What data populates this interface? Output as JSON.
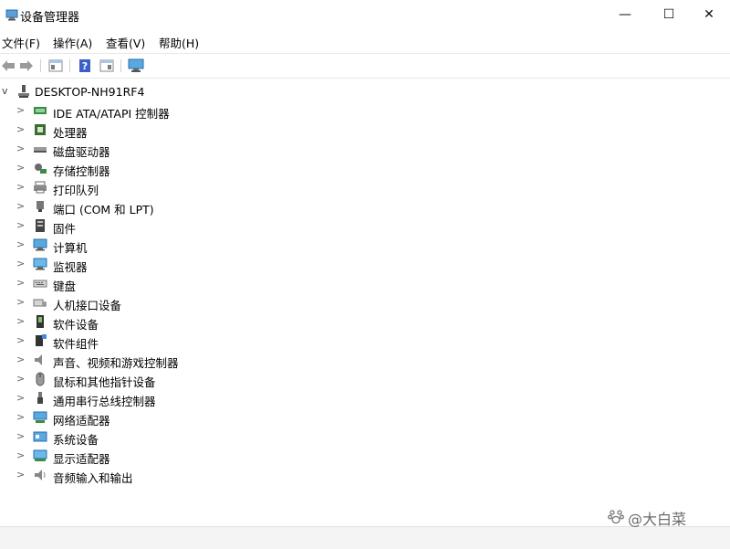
{
  "window": {
    "title": "设备管理器",
    "minimize_glyph": "—",
    "maximize_glyph": "☐",
    "close_glyph": "✕"
  },
  "menu": [
    "文件(F)",
    "操作(A)",
    "查看(V)",
    "帮助(H)"
  ],
  "toolbar": [
    "back-icon",
    "forward-icon",
    "properties-icon",
    "help-icon",
    "view-icon",
    "monitor-scan-icon"
  ],
  "tree": {
    "root": {
      "label": "DESKTOP-NH91RF4",
      "expanded": true,
      "toggle_glyph": "v",
      "icon": "computer-icon"
    },
    "collapsed_glyph": ">",
    "items": [
      {
        "label": "IDE ATA/ATAPI 控制器",
        "icon": "ide-controller-icon"
      },
      {
        "label": "处理器",
        "icon": "processor-icon"
      },
      {
        "label": "磁盘驱动器",
        "icon": "disk-drive-icon"
      },
      {
        "label": "存储控制器",
        "icon": "storage-controller-icon"
      },
      {
        "label": "打印队列",
        "icon": "printer-icon"
      },
      {
        "label": "端口 (COM 和 LPT)",
        "icon": "port-icon"
      },
      {
        "label": "固件",
        "icon": "firmware-icon"
      },
      {
        "label": "计算机",
        "icon": "computer-icon"
      },
      {
        "label": "监视器",
        "icon": "monitor-icon"
      },
      {
        "label": "键盘",
        "icon": "keyboard-icon"
      },
      {
        "label": "人机接口设备",
        "icon": "hid-icon"
      },
      {
        "label": "软件设备",
        "icon": "software-device-icon"
      },
      {
        "label": "软件组件",
        "icon": "software-component-icon"
      },
      {
        "label": "声音、视频和游戏控制器",
        "icon": "sound-icon"
      },
      {
        "label": "鼠标和其他指针设备",
        "icon": "mouse-icon"
      },
      {
        "label": "通用串行总线控制器",
        "icon": "usb-icon"
      },
      {
        "label": "网络适配器",
        "icon": "network-adapter-icon"
      },
      {
        "label": "系统设备",
        "icon": "system-device-icon"
      },
      {
        "label": "显示适配器",
        "icon": "display-adapter-icon"
      },
      {
        "label": "音频输入和输出",
        "icon": "audio-io-icon"
      }
    ]
  },
  "watermark": {
    "text": "@大白菜"
  }
}
